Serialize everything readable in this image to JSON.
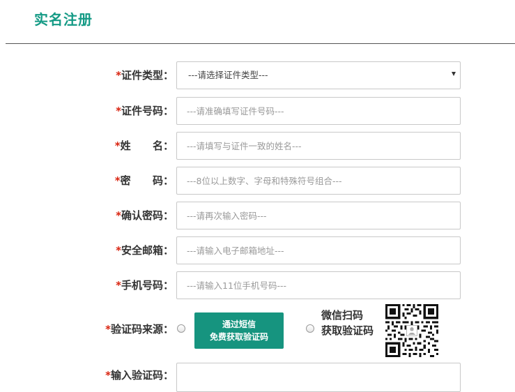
{
  "page": {
    "title": "实名注册"
  },
  "form": {
    "id_type": {
      "required_mark": "*",
      "label": "证件类型：",
      "selected": "---请选择证件类型---"
    },
    "id_number": {
      "required_mark": "*",
      "label": "证件号码：",
      "placeholder": "---请准确填写证件号码---"
    },
    "name": {
      "required_mark": "*",
      "label": "姓      名：",
      "placeholder": "---请填写与证件一致的姓名---"
    },
    "password": {
      "required_mark": "*",
      "label": "密      码：",
      "placeholder": "---8位以上数字、字母和特殊符号组合---"
    },
    "confirm_password": {
      "required_mark": "*",
      "label": "确认密码：",
      "placeholder": "---请再次输入密码---"
    },
    "email": {
      "required_mark": "*",
      "label": "安全邮箱：",
      "placeholder": "---请输入电子邮箱地址---"
    },
    "phone": {
      "required_mark": "*",
      "label": "手机号码：",
      "placeholder": "---请输入11位手机号码---"
    },
    "code_source": {
      "required_mark": "*",
      "label": "验证码来源：",
      "sms_button_line1": "通过短信",
      "sms_button_line2": "免费获取验证码",
      "wechat_line1": "微信扫码",
      "wechat_line2": "获取验证码"
    },
    "verify_code": {
      "required_mark": "*",
      "label": "输入验证码：",
      "value": ""
    }
  },
  "colors": {
    "brand": "#149a85",
    "button": "#16947f",
    "required": "#d9230f",
    "border": "#c8c8c8"
  },
  "icons": {
    "select_caret": "caret-down-icon",
    "qr": "wechat-qr-code-icon"
  }
}
